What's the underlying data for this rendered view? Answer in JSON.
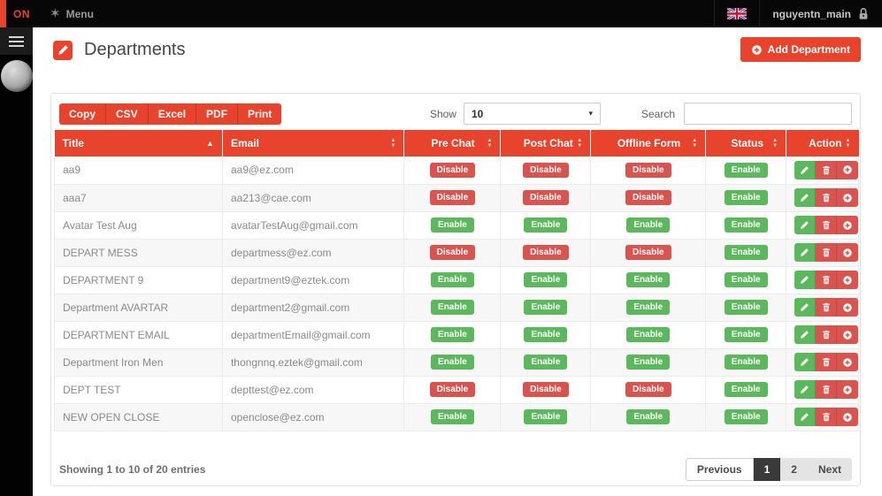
{
  "topbar": {
    "on_label": "ON",
    "menu_label": "Menu",
    "username": "nguyentn_main"
  },
  "icons": {
    "menu_star": "✶",
    "caret_down": "▾",
    "sort_asc": "▲",
    "sort_up": "▲",
    "sort_down": "▼"
  },
  "header": {
    "title": "Departments",
    "add_button_label": "Add Department"
  },
  "toolbar": {
    "export_buttons": [
      "Copy",
      "CSV",
      "Excel",
      "PDF",
      "Print"
    ],
    "show_label": "Show",
    "show_value": "10",
    "search_label": "Search",
    "search_value": ""
  },
  "table": {
    "columns": [
      {
        "label": "Title",
        "sort": "asc"
      },
      {
        "label": "Email",
        "sort": "both"
      },
      {
        "label": "Pre Chat",
        "sort": "both"
      },
      {
        "label": "Post Chat",
        "sort": "both"
      },
      {
        "label": "Offline Form",
        "sort": "both"
      },
      {
        "label": "Status",
        "sort": "both"
      },
      {
        "label": "Action",
        "sort": "both"
      }
    ],
    "rows": [
      {
        "title": "aa9",
        "email": "aa9@ez.com",
        "pre_chat": "Disable",
        "post_chat": "Disable",
        "offline_form": "Disable",
        "status": "Enable"
      },
      {
        "title": "aaa7",
        "email": "aa213@cae.com",
        "pre_chat": "Disable",
        "post_chat": "Disable",
        "offline_form": "Disable",
        "status": "Enable"
      },
      {
        "title": "Avatar Test Aug",
        "email": "avatarTestAug@gmail.com",
        "pre_chat": "Enable",
        "post_chat": "Enable",
        "offline_form": "Enable",
        "status": "Enable"
      },
      {
        "title": "DEPART MESS",
        "email": "departmess@ez.com",
        "pre_chat": "Disable",
        "post_chat": "Disable",
        "offline_form": "Disable",
        "status": "Enable"
      },
      {
        "title": "DEPARTMENT 9",
        "email": "department9@eztek.com",
        "pre_chat": "Enable",
        "post_chat": "Enable",
        "offline_form": "Enable",
        "status": "Enable"
      },
      {
        "title": "Department AVARTAR",
        "email": "department2@gmail.com",
        "pre_chat": "Enable",
        "post_chat": "Enable",
        "offline_form": "Enable",
        "status": "Enable"
      },
      {
        "title": "DEPARTMENT EMAIL",
        "email": "departmentEmail@gmail.com",
        "pre_chat": "Enable",
        "post_chat": "Enable",
        "offline_form": "Enable",
        "status": "Enable"
      },
      {
        "title": "Department Iron Men",
        "email": "thongnnq.eztek@gmail.com",
        "pre_chat": "Enable",
        "post_chat": "Enable",
        "offline_form": "Enable",
        "status": "Enable"
      },
      {
        "title": "DEPT TEST",
        "email": "depttest@ez.com",
        "pre_chat": "Disable",
        "post_chat": "Disable",
        "offline_form": "Disable",
        "status": "Enable"
      },
      {
        "title": "NEW OPEN CLOSE",
        "email": "openclose@ez.com",
        "pre_chat": "Enable",
        "post_chat": "Enable",
        "offline_form": "Enable",
        "status": "Enable"
      }
    ]
  },
  "footer": {
    "showing_text": "Showing 1 to 10 of 20 entries",
    "pagination": [
      "Previous",
      "1",
      "2",
      "Next"
    ],
    "active_page": "1"
  },
  "colors": {
    "accent_red": "#e8442d",
    "badge_red": "#d9534f",
    "badge_green": "#5cb85c",
    "topbar_black": "#070707"
  }
}
